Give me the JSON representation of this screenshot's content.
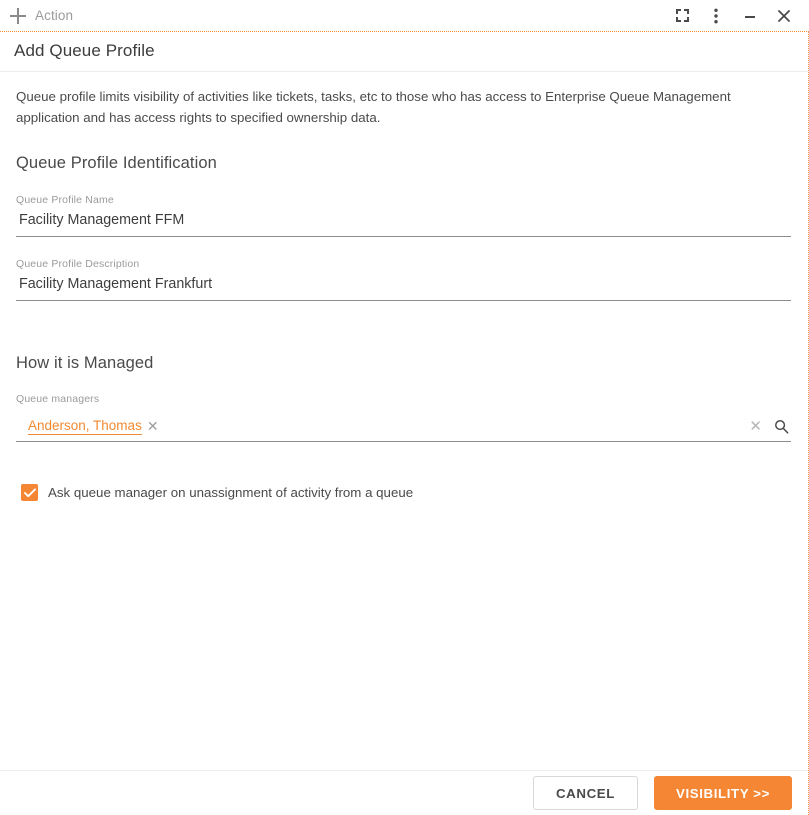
{
  "titlebar": {
    "add_icon": "plus-icon",
    "action_label": "Action",
    "controls": [
      {
        "name": "expand-icon",
        "title": "Expand"
      },
      {
        "name": "more-options-icon",
        "title": "More options"
      },
      {
        "name": "minimize-icon",
        "title": "Minimize"
      },
      {
        "name": "close-icon",
        "title": "Close"
      }
    ]
  },
  "dialog": {
    "title": "Add Queue Profile",
    "intro": "Queue profile limits visibility of activities like tickets, tasks, etc to those who has access to Enterprise Queue Management application and has access rights to specified ownership data."
  },
  "identification": {
    "heading": "Queue Profile Identification",
    "name_field": {
      "label": "Queue Profile Name",
      "value": "Facility Management FFM",
      "placeholder": ""
    },
    "description_field": {
      "label": "Queue Profile Description",
      "value": "Facility Management Frankfurt",
      "placeholder": ""
    }
  },
  "managed": {
    "heading": "How it is Managed",
    "managers_field": {
      "label": "Queue managers",
      "placeholder": "",
      "chips": [
        {
          "label": "Anderson, Thomas",
          "remove_icon": "close-icon"
        }
      ],
      "clear_icon": "clear-icon",
      "search_icon": "search-icon"
    },
    "checkbox": {
      "checked": true,
      "icon": "checkmark-icon",
      "label": "Ask queue manager on unassignment of activity from a queue"
    }
  },
  "footer": {
    "cancel_label": "CANCEL",
    "primary_label": "VISIBILITY >>"
  },
  "colors": {
    "accent": "#F58634",
    "chip_text": "#F08A33",
    "dotted_border": "#EF8F44",
    "text": "#4A4A4A",
    "muted": "#9B9B9B"
  }
}
